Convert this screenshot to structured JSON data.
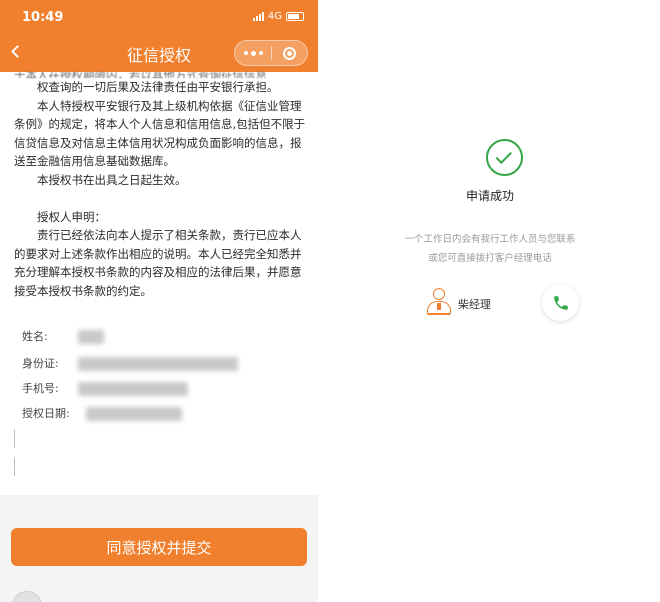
{
  "status": {
    "time": "10:49",
    "network": "4G"
  },
  "nav": {
    "title": "征信授权"
  },
  "document": {
    "cut_line_1": "于本人在授权期限内，若以其他方式查询征信信息",
    "cut_line_2": "权查询的一切后果及法律责任由平安银行承担。",
    "para1": "本人特授权平安银行及其上级机构依据《征信业管理条例》的规定，将本人个人信息和信用信息,包括但不限于信贷信息及对信息主体信用状况构成负面影响的信息，报送至金融信用信息基础数据库。",
    "para2": "本授权书在出具之日起生效。",
    "declaration_title": "授权人申明：",
    "declaration": "责行已经依法向本人提示了相关条款，责行已应本人的要求对上述条款作出相应的说明。本人已经完全知悉并充分理解本授权书条款的内容及相应的法律后果，并愿意接受本授权书条款的约定。"
  },
  "fields": [
    {
      "label": "姓名:"
    },
    {
      "label": "身份证:"
    },
    {
      "label": "手机号:"
    },
    {
      "label": "授权日期:"
    }
  ],
  "submit_label": "同意授权并提交",
  "success": {
    "title": "申请成功",
    "line1": "一个工作日内会有我行工作人员与您联系",
    "line2": "或您可直接拨打客户经理电话",
    "manager_name": "柴经理"
  },
  "colors": {
    "brand": "#f0802e",
    "success": "#33a745"
  }
}
